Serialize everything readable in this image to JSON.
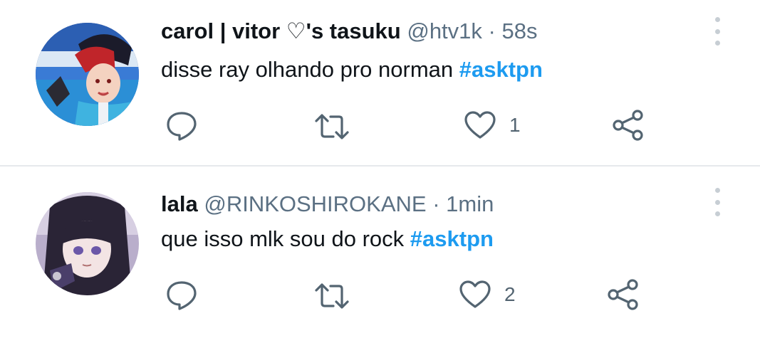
{
  "tweets": [
    {
      "name": "carol | vitor ♡'s tasuku",
      "handle": "@htv1k",
      "separator": "·",
      "time": "58s",
      "text": "disse ray olhando pro norman",
      "hashtag": "#asktpn",
      "reply_count": "",
      "retweet_count": "",
      "like_count": "1"
    },
    {
      "name": "lala",
      "handle": "@RINKOSHIROKANE",
      "separator": "·",
      "time": "1min",
      "text": "que isso mlk sou do rock",
      "hashtag": "#asktpn",
      "reply_count": "",
      "retweet_count": "",
      "like_count": "2"
    }
  ],
  "colors": {
    "hashtag": "#1d9bf0",
    "secondary_text": "#5b7083",
    "divider": "#e6e9ec",
    "icon": "#536471"
  },
  "icons": [
    "reply-icon",
    "retweet-icon",
    "like-icon",
    "share-icon",
    "more-options-icon"
  ]
}
